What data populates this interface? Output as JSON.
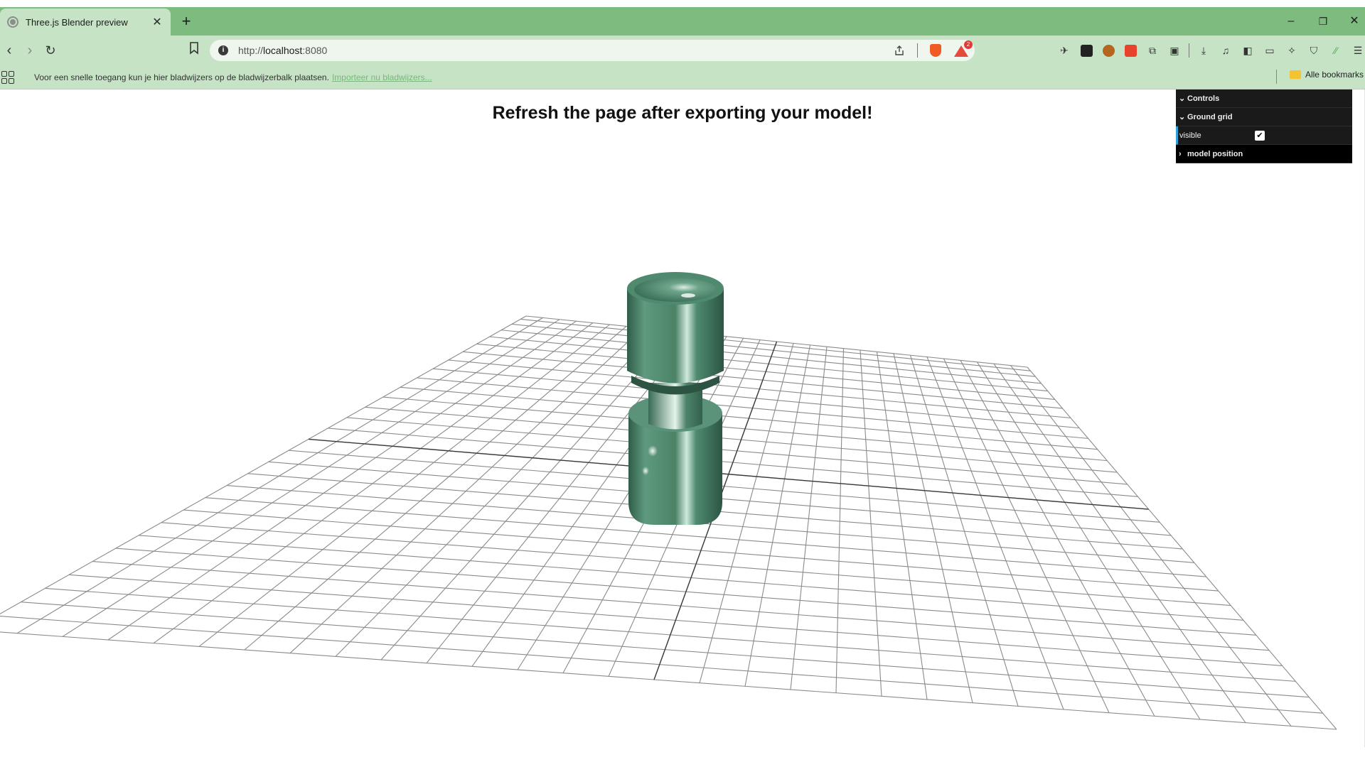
{
  "browser": {
    "tab": {
      "title": "Three.js Blender preview"
    },
    "new_tab_symbol": "+",
    "window_controls": {
      "minimize": "–",
      "restore": "❐",
      "close": "✕"
    },
    "address": {
      "scheme": "http://",
      "host": "localhost",
      "port": ":8080"
    },
    "bat_badge_count": "2",
    "bookmarks_bar": {
      "hint": "Voor een snelle toegang kun je hier bladwijzers op de bladwijzerbalk plaatsen.",
      "import_link": "Importeer nu bladwijzers...",
      "all_bookmarks": "Alle bookmarks"
    },
    "extension_icons": [
      "rocket-icon",
      "terminal-icon",
      "cookie-icon",
      "translate-icon",
      "puzzle-icon",
      "reader-icon",
      "download-icon",
      "media-icon",
      "sidebar-icon",
      "wallet-icon",
      "leo-ai-icon",
      "vpn-shield-icon",
      "slash-icon",
      "menu-icon"
    ]
  },
  "page": {
    "heading": "Refresh the page after exporting your model!"
  },
  "gui": {
    "controls_label": "Controls",
    "ground_grid_label": "Ground grid",
    "visible_label": "visible",
    "visible_checked": true,
    "model_position_label": "model position"
  },
  "colors": {
    "tabstrip": "#7dbb7f",
    "toolbar": "#c6e3c6",
    "model": "#4f8a6f",
    "gui_bg": "#1a1a1a"
  }
}
